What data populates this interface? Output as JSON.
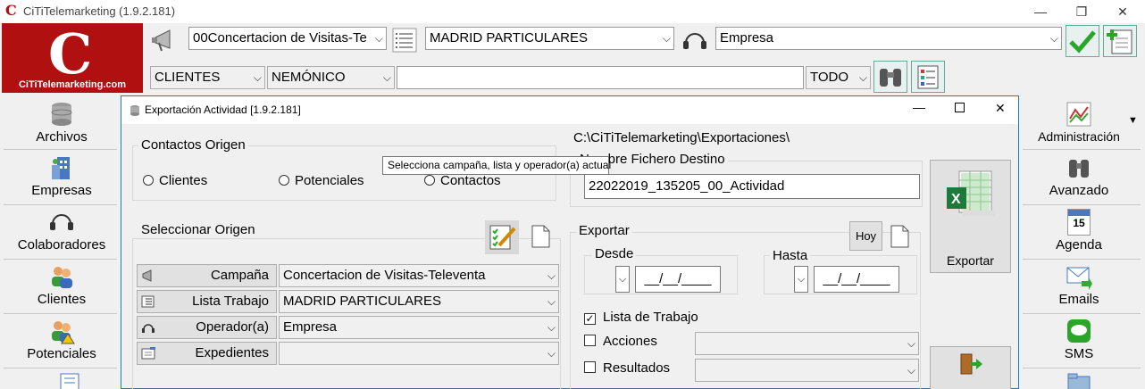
{
  "app": {
    "title": "CiTiTelemarketing  (1.9.2.181)",
    "logo_letter": "C",
    "logo_text": "CiTiTelemarketing.com",
    "window_buttons": {
      "minimize": "—",
      "restore": "❐",
      "close": "✕"
    }
  },
  "toolbar": {
    "campaign_value": "00Concertacion de Visitas-Te",
    "list_value": "MADRID PARTICULARES",
    "operator_value": "Empresa",
    "type_value": "CLIENTES",
    "field_value": "NEMÓNICO",
    "search_value": "",
    "scope_value": "TODO"
  },
  "sidebar_left": {
    "items": [
      {
        "label": "Archivos"
      },
      {
        "label": "Empresas"
      },
      {
        "label": "Colaboradores"
      },
      {
        "label": "Clientes"
      },
      {
        "label": "Potenciales"
      }
    ]
  },
  "sidebar_right": {
    "items": [
      {
        "label": "Administración"
      },
      {
        "label": "Avanzado"
      },
      {
        "label": "Agenda"
      },
      {
        "label": "Emails"
      },
      {
        "label": "SMS"
      }
    ],
    "calendar_day": "15"
  },
  "dialog": {
    "title": "Exportación Actividad [1.9.2.181]",
    "contactos_origen": {
      "label": "Contactos Origen",
      "options": [
        "Clientes",
        "Potenciales",
        "Contactos"
      ]
    },
    "seleccionar_origen": {
      "label": "Seleccionar Origen",
      "rows": [
        {
          "label": "Campaña",
          "value": "Concertacion de Visitas-Televenta"
        },
        {
          "label": "Lista Trabajo",
          "value": "MADRID PARTICULARES"
        },
        {
          "label": "Operador(a)",
          "value": "Empresa"
        },
        {
          "label": "Expedientes",
          "value": ""
        }
      ]
    },
    "path": "C:\\CiTiTelemarketing\\Exportaciones\\",
    "nombre_fichero": {
      "label": "Nombre Fichero Destino",
      "value": "22022019_135205_00_Actividad"
    },
    "exportar_button": "Exportar",
    "exportar_group": {
      "label": "Exportar",
      "hoy_button": "Hoy",
      "desde_label": "Desde",
      "hasta_label": "Hasta",
      "desde_value": "__/__/____",
      "hasta_value": "__/__/____",
      "checks": [
        {
          "label": "Lista de Trabajo",
          "checked": true
        },
        {
          "label": "Acciones",
          "checked": false
        },
        {
          "label": "Resultados",
          "checked": false
        }
      ]
    },
    "tooltip": "Selecciona campaña, lista y operador(a) actual"
  }
}
